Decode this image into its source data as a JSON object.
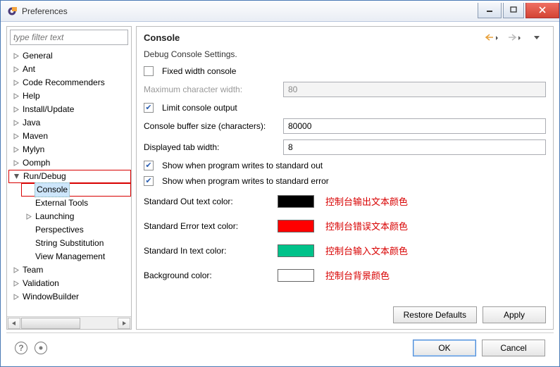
{
  "window": {
    "title": "Preferences"
  },
  "filter": {
    "placeholder": "type filter text"
  },
  "tree": {
    "items": [
      {
        "label": "General"
      },
      {
        "label": "Ant"
      },
      {
        "label": "Code Recommenders"
      },
      {
        "label": "Help"
      },
      {
        "label": "Install/Update"
      },
      {
        "label": "Java"
      },
      {
        "label": "Maven"
      },
      {
        "label": "Mylyn"
      },
      {
        "label": "Oomph"
      }
    ],
    "runDebug": {
      "label": "Run/Debug",
      "children": [
        {
          "label": "Console"
        },
        {
          "label": "External Tools"
        },
        {
          "label": "Launching"
        },
        {
          "label": "Perspectives"
        },
        {
          "label": "String Substitution"
        },
        {
          "label": "View Management"
        }
      ]
    },
    "tail": [
      {
        "label": "Team"
      },
      {
        "label": "Validation"
      },
      {
        "label": "WindowBuilder"
      }
    ]
  },
  "page": {
    "title": "Console",
    "subtitle": "Debug Console Settings.",
    "fixedWidth": {
      "label": "Fixed width console",
      "checked": false
    },
    "maxCharWidth": {
      "label": "Maximum character width:",
      "value": "80"
    },
    "limitOutput": {
      "label": "Limit console output",
      "checked": true
    },
    "bufferSize": {
      "label": "Console buffer size (characters):",
      "value": "80000"
    },
    "tabWidth": {
      "label": "Displayed tab width:",
      "value": "8"
    },
    "showStdout": {
      "label": "Show when program writes to standard out",
      "checked": true
    },
    "showStderr": {
      "label": "Show when program writes to standard error",
      "checked": true
    },
    "colors": {
      "stdout": {
        "label": "Standard Out text color:",
        "value": "#000000",
        "annot": "控制台输出文本颜色"
      },
      "stderr": {
        "label": "Standard Error text color:",
        "value": "#ff0000",
        "annot": "控制台错误文本颜色"
      },
      "stdin": {
        "label": "Standard In text color:",
        "value": "#00c28a",
        "annot": "控制台输入文本颜色"
      },
      "bg": {
        "label": "Background color:",
        "value": "#ffffff",
        "annot": "控制台背景颜色"
      }
    },
    "restore": "Restore Defaults",
    "apply": "Apply"
  },
  "footer": {
    "ok": "OK",
    "cancel": "Cancel"
  }
}
